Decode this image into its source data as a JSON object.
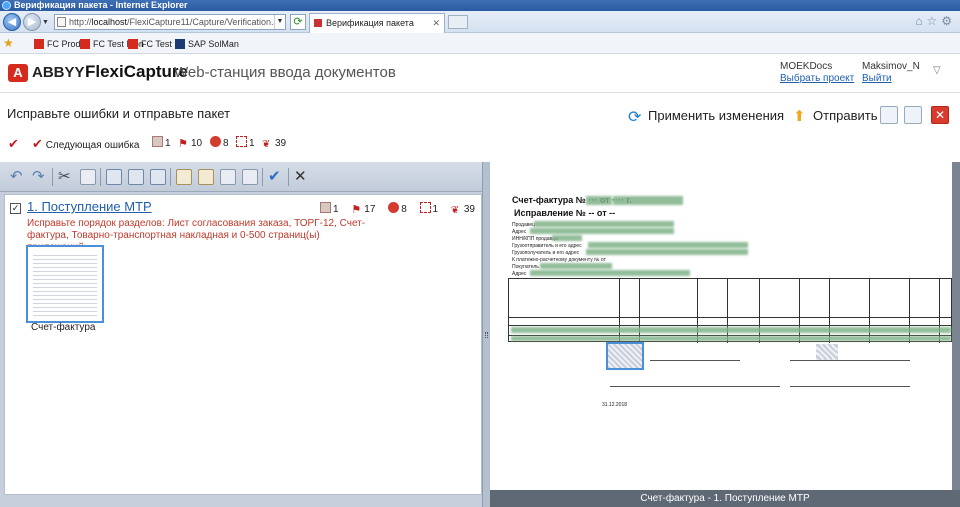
{
  "browser": {
    "window_title": "Верификация пакета - Internet Explorer",
    "url_prefix": "http://",
    "url_host": "localhost",
    "url_path": "/FlexiCapture11/Capture/Verification.asp",
    "tab_title": "Верификация пакета",
    "favorites": [
      "FC Prod",
      "FC Test Mon",
      "FC Test",
      "SAP SolMan"
    ]
  },
  "header": {
    "logo_mark": "A",
    "brand": "ABBYY",
    "product": "FlexiCapture",
    "subtitle": "Web-станция ввода документов",
    "org": "MOEKDocs",
    "select_project": "Выбрать проект",
    "user": "Maksimov_N",
    "logout": "Выйти"
  },
  "page": {
    "title": "Исправьте ошибки и отправьте пакет",
    "apply_changes": "Применить изменения",
    "send": "Отправить"
  },
  "error_toolbar": {
    "next_error": "Следующая ошибка",
    "counters": [
      "1",
      "10",
      "8",
      "1",
      "39"
    ]
  },
  "document": {
    "title": "1. Поступление МТР",
    "counters": [
      "1",
      "17",
      "8",
      "1",
      "39"
    ],
    "error_message": "Исправьте порядок разделов: Лист согласования заказа, ТОРГ-12, Счет-фактура, Товарно-транспортная накладная и 0-500 страниц(ы) приложений.",
    "thumbnail_label": "Счет-фактура"
  },
  "image_view": {
    "caption": "Счет-фактура - 1. Поступление МТР",
    "heading_1": "Счет-фактура № ··· от ···· г.",
    "heading_2": "Исправление № -- от --",
    "date_text": "31.12.2018"
  },
  "colors": {
    "accent_link": "#1f5fae",
    "error_red": "#c0392b",
    "brand_red": "#d52b1e"
  }
}
